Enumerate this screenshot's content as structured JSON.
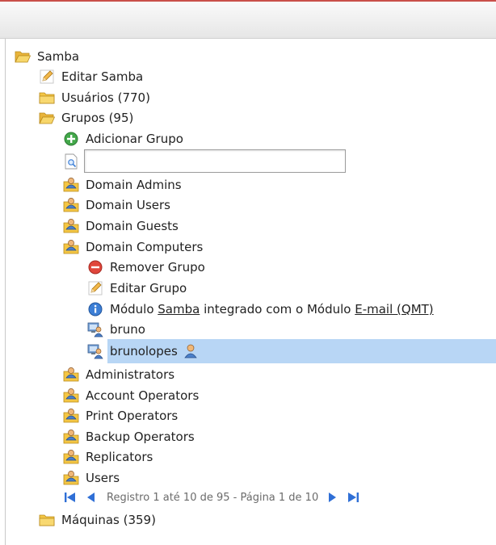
{
  "tree": {
    "root": {
      "label": "Samba",
      "icon": "folder-open-icon"
    },
    "edit_samba": {
      "label": "Editar Samba",
      "icon": "pencil-icon"
    },
    "users": {
      "label": "Usuários (770)",
      "icon": "folder-icon"
    },
    "groups": {
      "label": "Grupos (95)",
      "icon": "folder-open-icon",
      "add_group": {
        "label": "Adicionar Grupo",
        "icon": "add-green-icon"
      },
      "search": {
        "value": "",
        "placeholder": ""
      },
      "items_before": [
        {
          "label": "Domain Admins"
        },
        {
          "label": "Domain Users"
        },
        {
          "label": "Domain Guests"
        },
        {
          "label": "Domain Computers"
        }
      ],
      "expanded": {
        "remove_group": {
          "label": "Remover Grupo",
          "icon": "remove-red-icon"
        },
        "edit_group": {
          "label": "Editar Grupo",
          "icon": "pencil-icon"
        },
        "info": {
          "icon": "info-icon",
          "text_1": "Módulo ",
          "link_1": "Samba",
          "text_2": " integrado com o Módulo ",
          "link_2": "E-mail (QMT)"
        },
        "members": [
          {
            "label": "bruno",
            "icon": "computer-user-icon"
          },
          {
            "label": "brunolopes",
            "icon": "computer-user-icon",
            "selected": true
          }
        ]
      },
      "items_after": [
        {
          "label": "Administrators"
        },
        {
          "label": "Account Operators"
        },
        {
          "label": "Print Operators"
        },
        {
          "label": "Backup Operators"
        },
        {
          "label": "Replicators"
        },
        {
          "label": "Users"
        }
      ],
      "pager": {
        "text": "Registro 1 até 10 de 95 - Página 1 de 10",
        "color": "#2f6fd6"
      }
    },
    "machines": {
      "label": "Máquinas (359)",
      "icon": "folder-icon"
    }
  },
  "colors": {
    "selection": "#b8d6f5",
    "folder": "#f4c644",
    "accent_bar": "#c9504a"
  }
}
